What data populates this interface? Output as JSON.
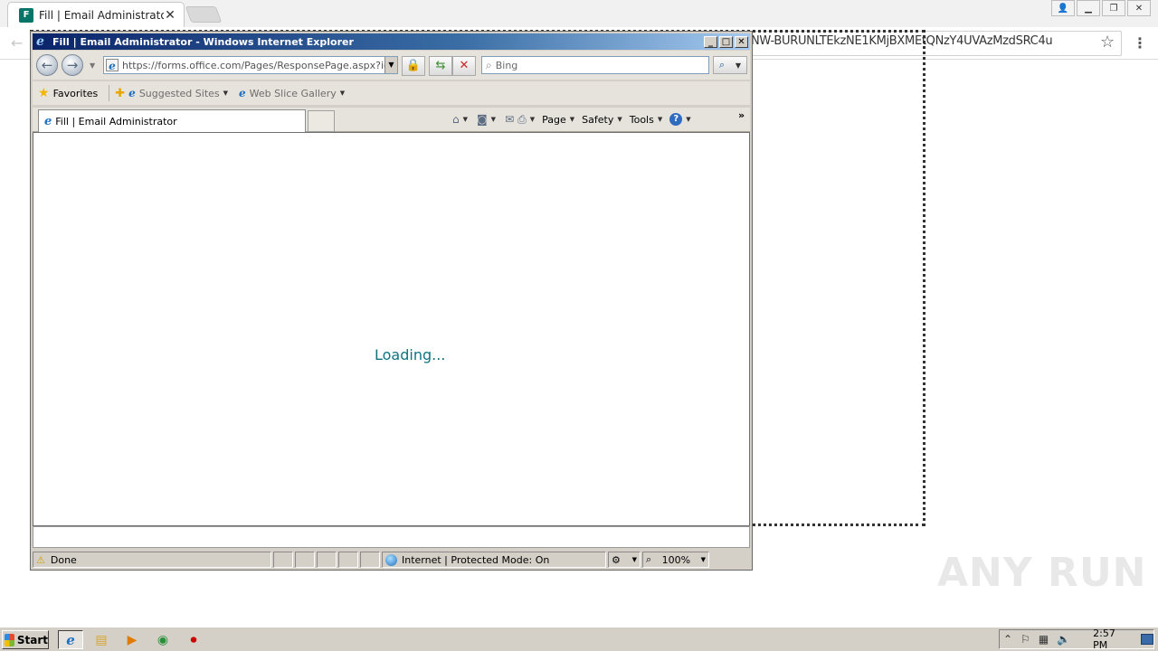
{
  "chrome": {
    "tab_title": "Fill | Email Administrator",
    "tab_favicon_letter": "F",
    "url_tail": "NW-BURUNLTEkzNE1KMjBXMEtQNzY4UVAzMzdSRC4u"
  },
  "ie": {
    "window_title": "Fill | Email Administrator - Windows Internet Explorer",
    "address_url": "https://forms.office.com/Pages/ResponsePage.aspx?id=m",
    "search_placeholder": "Bing",
    "favorites": {
      "favorites_label": "Favorites",
      "suggested_sites": "Suggested Sites",
      "web_slice_gallery": "Web Slice Gallery"
    },
    "tab_title": "Fill | Email Administrator",
    "commands": {
      "page": "Page",
      "safety": "Safety",
      "tools": "Tools"
    },
    "content": {
      "loading_text": "Loading..."
    },
    "status": {
      "text": "Done",
      "zone": "Internet | Protected Mode: On",
      "zoom": "100%"
    }
  },
  "taskbar": {
    "start_label": "Start",
    "clock": "2:57 PM"
  },
  "watermark": "ANY RUN"
}
